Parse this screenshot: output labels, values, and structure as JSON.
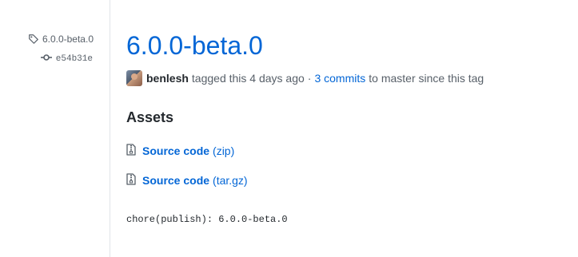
{
  "sidebar": {
    "tag_name": "6.0.0-beta.0",
    "commit_sha": "e54b31e"
  },
  "release": {
    "title": "6.0.0-beta.0",
    "author": "benlesh",
    "tagged_text": "tagged this 4 days ago",
    "separator": "·",
    "commits_link": "3 commits",
    "commits_suffix": "to master since this tag"
  },
  "assets": {
    "heading": "Assets",
    "items": [
      {
        "name": "Source code",
        "ext": "(zip)"
      },
      {
        "name": "Source code",
        "ext": "(tar.gz)"
      }
    ]
  },
  "commit_message": "chore(publish): 6.0.0-beta.0",
  "colors": {
    "link": "#0366d6",
    "muted": "#586069",
    "text": "#24292e",
    "border": "#e1e4e8"
  }
}
